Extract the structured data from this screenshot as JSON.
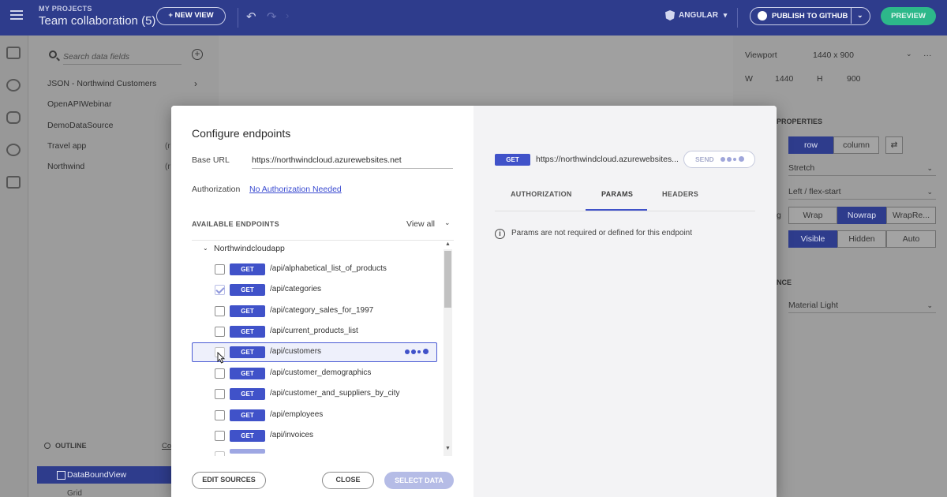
{
  "topbar": {
    "project_label": "MY PROJECTS",
    "project_title": "Team collaboration (5)",
    "new_view_label": "+ NEW VIEW",
    "framework_label": "ANGULAR",
    "framework_chevron": "▾",
    "publish_label": "PUBLISH TO GITHUB",
    "publish_chevron": "⌄",
    "preview_label": "PREVIEW",
    "undo_glyph": "↶",
    "redo_glyph": "↷",
    "forward_glyph": "›"
  },
  "data_panel": {
    "search_placeholder": "Search data fields",
    "sources": [
      {
        "label": "JSON - Northwind Customers",
        "suffix": ""
      },
      {
        "label": "OpenAPIWebinar",
        "suffix": ""
      },
      {
        "label": "DemoDataSource",
        "suffix": ""
      },
      {
        "label": "Travel app",
        "suffix": "(r"
      },
      {
        "label": "Northwind",
        "suffix": "(r"
      }
    ],
    "chevron": "›",
    "outline_label": "OUTLINE",
    "collapse_label": "Co",
    "outline_selected": "DataBoundView",
    "outline_child": "Grid"
  },
  "right_panel": {
    "viewport_label": "Viewport",
    "viewport_value": "1440 x 900",
    "more_glyph": "···",
    "w_label": "W",
    "w_value": "1440",
    "h_label": "H",
    "h_value": "900",
    "properties_label": "PROPERTIES",
    "direction_options": [
      "row",
      "column"
    ],
    "direction_selected": "row",
    "swap_glyph": "⇄",
    "stretch_value": "Stretch",
    "justify_value": "Left / flex-start",
    "wrap_options": [
      "Wrap",
      "Nowrap",
      "WrapRe..."
    ],
    "wrap_selected": "Nowrap",
    "overflow_options": [
      "Visible",
      "Hidden",
      "Auto"
    ],
    "overflow_selected": "Visible",
    "appearance_label": "NCE",
    "theme_value": "Material Light",
    "row_label_fragment": "g",
    "select_chevron": "⌄"
  },
  "modal": {
    "title": "Configure endpoints",
    "base_url_label": "Base URL",
    "base_url_value": "https://northwindcloud.azurewebsites.net",
    "authorization_label": "Authorization",
    "authorization_link": "No Authorization Needed",
    "available_label": "AVAILABLE ENDPOINTS",
    "view_all_label": "View all",
    "view_all_chevron": "⌄",
    "group_name": "Northwindcloudapp",
    "group_chevron": "⌄",
    "endpoints": [
      {
        "method": "GET",
        "path": "/api/alphabetical_list_of_products",
        "checked": false
      },
      {
        "method": "GET",
        "path": "/api/categories",
        "checked": true
      },
      {
        "method": "GET",
        "path": "/api/category_sales_for_1997",
        "checked": false
      },
      {
        "method": "GET",
        "path": "/api/current_products_list",
        "checked": false
      },
      {
        "method": "GET",
        "path": "/api/customers",
        "checked": false
      },
      {
        "method": "GET",
        "path": "/api/customer_demographics",
        "checked": false
      },
      {
        "method": "GET",
        "path": "/api/customer_and_suppliers_by_city",
        "checked": false
      },
      {
        "method": "GET",
        "path": "/api/employees",
        "checked": false
      },
      {
        "method": "GET",
        "path": "/api/invoices",
        "checked": false
      }
    ],
    "edit_sources_label": "EDIT SOURCES",
    "close_label": "CLOSE",
    "select_data_label": "SELECT DATA",
    "scroll_up_glyph": "▲",
    "scroll_down_glyph": "▼"
  },
  "request_panel": {
    "method": "GET",
    "url": "https://northwindcloud.azurewebsites...",
    "send_label": "SEND",
    "tabs": [
      "AUTHORIZATION",
      "PARAMS",
      "HEADERS"
    ],
    "active_tab": "PARAMS",
    "info_glyph": "i",
    "info_text": "Params are not required or defined for this endpoint"
  },
  "colors": {
    "brand": "#2e3c8c",
    "method_badge": "#4052c9",
    "preview_button": "#2db88a",
    "link": "#3a4bd1"
  }
}
